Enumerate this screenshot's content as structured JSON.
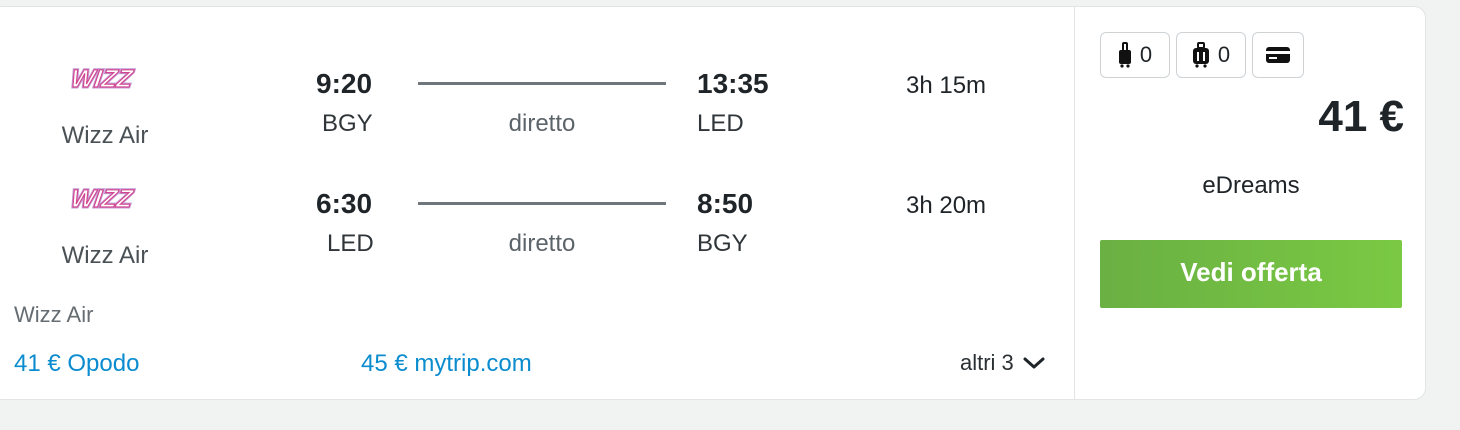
{
  "legs": [
    {
      "airline": "Wizz Air",
      "logo_text": "WIZZ",
      "depart_time": "9:20",
      "depart_code": "BGY",
      "stops": "diretto",
      "arrive_time": "13:35",
      "arrive_code": "LED",
      "duration": "3h 15m"
    },
    {
      "airline": "Wizz Air",
      "logo_text": "WIZZ",
      "depart_time": "6:30",
      "depart_code": "LED",
      "stops": "diretto",
      "arrive_time": "8:50",
      "arrive_code": "BGY",
      "duration": "3h 20m"
    }
  ],
  "operator": "Wizz Air",
  "other_deals": [
    {
      "label": "41 € Opodo"
    },
    {
      "label": "45 € mytrip.com"
    }
  ],
  "more_label": "altri 3",
  "fees": {
    "personal_item_count": "0",
    "cabin_bag_count": "0"
  },
  "price": "41 €",
  "provider": "eDreams",
  "cta_label": "Vedi offerta",
  "colors": {
    "link": "#0a8ccf",
    "cta": "#74bd43",
    "logo_pink": "#d2468f",
    "logo_purple": "#c69bd6"
  }
}
